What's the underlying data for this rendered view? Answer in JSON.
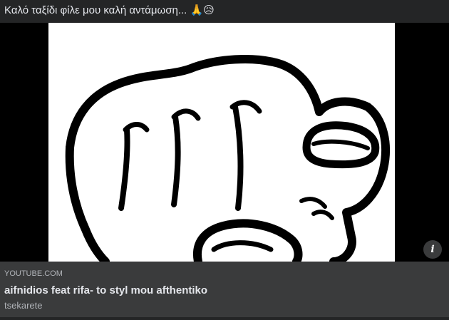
{
  "post": {
    "text": "Καλό ταξίδι φίλε μου καλή αντάμωση... 🙏😥"
  },
  "media": {
    "thumbnail_icon": "pointing-finger-icon",
    "info_label": "i",
    "info_icon": "info-icon"
  },
  "link_preview": {
    "domain": "YOUTUBE.COM",
    "title": "aifnidios feat rifa- to styl mou afthentiko",
    "description": "tsekarete"
  },
  "colors": {
    "background": "#242526",
    "card": "#3a3b3c",
    "text_primary": "#e4e6eb",
    "text_secondary": "#b0b3b8"
  }
}
